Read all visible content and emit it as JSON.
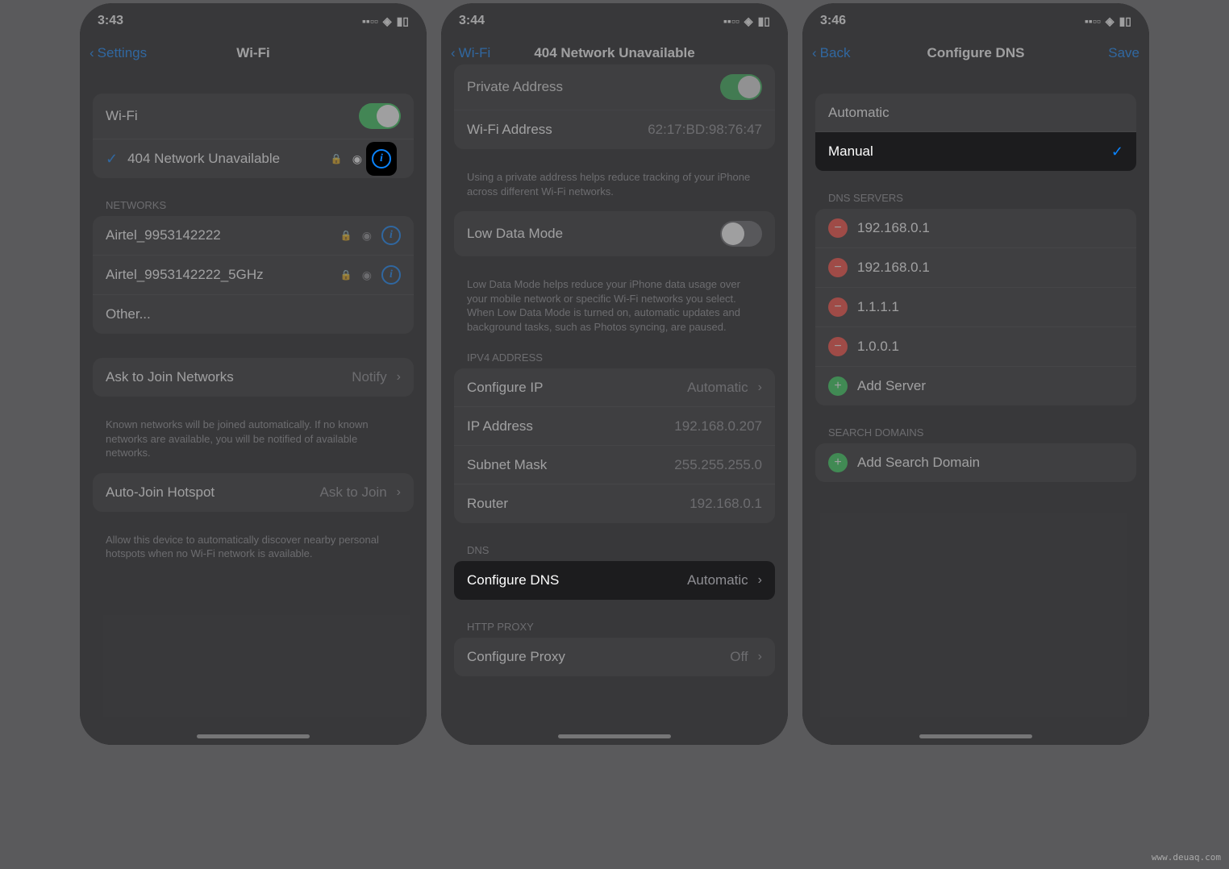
{
  "watermark": "www.deuaq.com",
  "screen1": {
    "time": "3:43",
    "back": "Settings",
    "title": "Wi-Fi",
    "wifi_label": "Wi-Fi",
    "connected": "404 Network Unavailable",
    "networks_header": "NETWORKS",
    "networks": [
      "Airtel_9953142222",
      "Airtel_9953142222_5GHz",
      "Other..."
    ],
    "ask_join_label": "Ask to Join Networks",
    "ask_join_value": "Notify",
    "ask_join_footer": "Known networks will be joined automatically. If no known networks are available, you will be notified of available networks.",
    "auto_join_label": "Auto-Join Hotspot",
    "auto_join_value": "Ask to Join",
    "auto_join_footer": "Allow this device to automatically discover nearby personal hotspots when no Wi-Fi network is available."
  },
  "screen2": {
    "time": "3:44",
    "back": "Wi-Fi",
    "title": "404 Network Unavailable",
    "private_addr_label": "Private Address",
    "wifi_addr_label": "Wi-Fi Address",
    "wifi_addr_value": "62:17:BD:98:76:47",
    "private_footer": "Using a private address helps reduce tracking of your iPhone across different Wi-Fi networks.",
    "low_data_label": "Low Data Mode",
    "low_data_footer": "Low Data Mode helps reduce your iPhone data usage over your mobile network or specific Wi-Fi networks you select. When Low Data Mode is turned on, automatic updates and background tasks, such as Photos syncing, are paused.",
    "ipv4_header": "IPV4 ADDRESS",
    "configure_ip_label": "Configure IP",
    "configure_ip_value": "Automatic",
    "ip_addr_label": "IP Address",
    "ip_addr_value": "192.168.0.207",
    "subnet_label": "Subnet Mask",
    "subnet_value": "255.255.255.0",
    "router_label": "Router",
    "router_value": "192.168.0.1",
    "dns_header": "DNS",
    "configure_dns_label": "Configure DNS",
    "configure_dns_value": "Automatic",
    "proxy_header": "HTTP PROXY",
    "configure_proxy_label": "Configure Proxy",
    "configure_proxy_value": "Off"
  },
  "screen3": {
    "time": "3:46",
    "back": "Back",
    "title": "Configure DNS",
    "save": "Save",
    "options": [
      "Automatic",
      "Manual"
    ],
    "selected": "Manual",
    "dns_header": "DNS SERVERS",
    "servers": [
      "192.168.0.1",
      "192.168.0.1",
      "1.1.1.1",
      "1.0.0.1"
    ],
    "add_server": "Add Server",
    "search_header": "SEARCH DOMAINS",
    "add_domain": "Add Search Domain"
  }
}
